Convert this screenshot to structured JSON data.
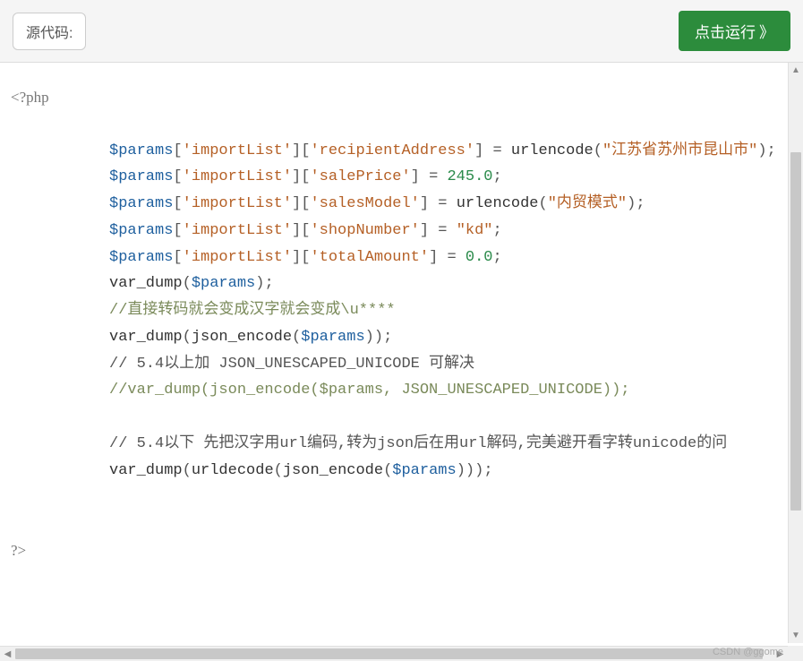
{
  "toolbar": {
    "source_label": "源代码:",
    "run_label": "点击运行",
    "run_icon": "》"
  },
  "code": {
    "open_tag": "<?php",
    "lines": [
      {
        "type": "assign",
        "var": "$params",
        "keys": [
          "'importList'",
          "'recipientAddress'"
        ],
        "func": "urlencode",
        "arg_str": "\"江苏省苏州市昆山市\"",
        "tail": ";"
      },
      {
        "type": "assign",
        "var": "$params",
        "keys": [
          "'importList'",
          "'salePrice'"
        ],
        "val": "245.0",
        "tail": ";"
      },
      {
        "type": "assign",
        "var": "$params",
        "keys": [
          "'importList'",
          "'salesModel'"
        ],
        "func": "urlencode",
        "arg_str": "\"内贸模式\"",
        "tail": ";"
      },
      {
        "type": "assign",
        "var": "$params",
        "keys": [
          "'importList'",
          "'shopNumber'"
        ],
        "val_str": "\"kd\"",
        "tail": ";"
      },
      {
        "type": "assign",
        "var": "$params",
        "keys": [
          "'importList'",
          "'totalAmount'"
        ],
        "val": "0.0",
        "tail": ";"
      },
      {
        "type": "call",
        "func": "var_dump",
        "arg_var": "$params",
        "tail": ";"
      },
      {
        "type": "comment",
        "text": "//直接转码就会变成汉字就会变成\\u****"
      },
      {
        "type": "call",
        "func": "var_dump",
        "inner_func": "json_encode",
        "arg_var": "$params",
        "tail": ";"
      },
      {
        "type": "comment-dark",
        "text": "// 5.4以上加 JSON_UNESCAPED_UNICODE 可解决"
      },
      {
        "type": "comment",
        "text": "//var_dump(json_encode($params, JSON_UNESCAPED_UNICODE));"
      },
      {
        "type": "blank"
      },
      {
        "type": "comment-dark",
        "text": "// 5.4以下 先把汉字用url编码,转为json后在用url解码,完美避开看字转unicode的问"
      },
      {
        "type": "call3",
        "func": "var_dump",
        "mid_func": "urldecode",
        "inner_func": "json_encode",
        "arg_var": "$params",
        "tail": ";"
      }
    ],
    "close_tag": "?>"
  },
  "watermark": "CSDN @ggome"
}
